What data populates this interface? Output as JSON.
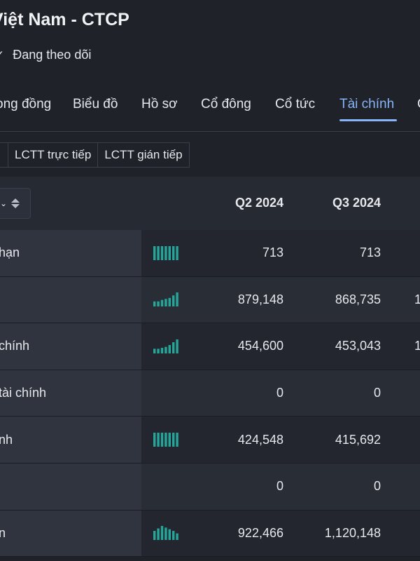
{
  "header": {
    "company_title": "Việt Nam - CTCP",
    "follow_label": "Đang theo dõi",
    "check_glyph": "✓"
  },
  "tabs": [
    {
      "label": "ong đồng",
      "active": false
    },
    {
      "label": "Biểu đồ",
      "active": false
    },
    {
      "label": "Hồ sơ",
      "active": false
    },
    {
      "label": "Cổ đông",
      "active": false
    },
    {
      "label": "Cổ tức",
      "active": false
    },
    {
      "label": "Tài chính",
      "active": true
    },
    {
      "label": "C",
      "active": false
    }
  ],
  "subtabs": [
    {
      "label": "LCTT trực tiếp"
    },
    {
      "label": "LCTT gián tiếp"
    }
  ],
  "table": {
    "sorter_icon": "sort-icon",
    "dropdown_glyph": "⌄",
    "columns": [
      "Q2 2024",
      "Q3 2024"
    ],
    "rows": [
      {
        "label": "hạn",
        "q2": "713",
        "q3": "713",
        "next": "",
        "spark": [
          5,
          5,
          5,
          5,
          5,
          5,
          5
        ],
        "spark_type": "flat"
      },
      {
        "label": "",
        "q2": "879,148",
        "q3": "868,735",
        "next": "1",
        "spark": [
          1,
          1,
          1.3,
          1.5,
          1.7,
          2.2,
          2.8
        ],
        "spark_type": "rising"
      },
      {
        "label": "chính",
        "q2": "454,600",
        "q3": "453,043",
        "next": "1",
        "spark": [
          1,
          1,
          1.2,
          1.4,
          1.8,
          2.4,
          3
        ],
        "spark_type": "rising"
      },
      {
        "label": "tài chính",
        "q2": "0",
        "q3": "0",
        "next": "",
        "spark": [],
        "spark_type": "none"
      },
      {
        "label": "nh",
        "q2": "424,548",
        "q3": "415,692",
        "next": "",
        "spark": [
          5,
          5,
          5,
          5,
          5,
          5,
          5
        ],
        "spark_type": "flat"
      },
      {
        "label": "",
        "q2": "0",
        "q3": "0",
        "next": "",
        "spark": [],
        "spark_type": "none"
      },
      {
        "label": "n",
        "q2": "922,466",
        "q3": "1,120,148",
        "next": "",
        "spark": [
          2.2,
          2.8,
          3.4,
          3,
          2.6,
          2.2,
          1.6
        ],
        "spark_type": "mixed"
      }
    ]
  },
  "colors": {
    "accent": "#8ab4f8",
    "spark_bar": "#26a69a",
    "background": "#1f2229"
  }
}
